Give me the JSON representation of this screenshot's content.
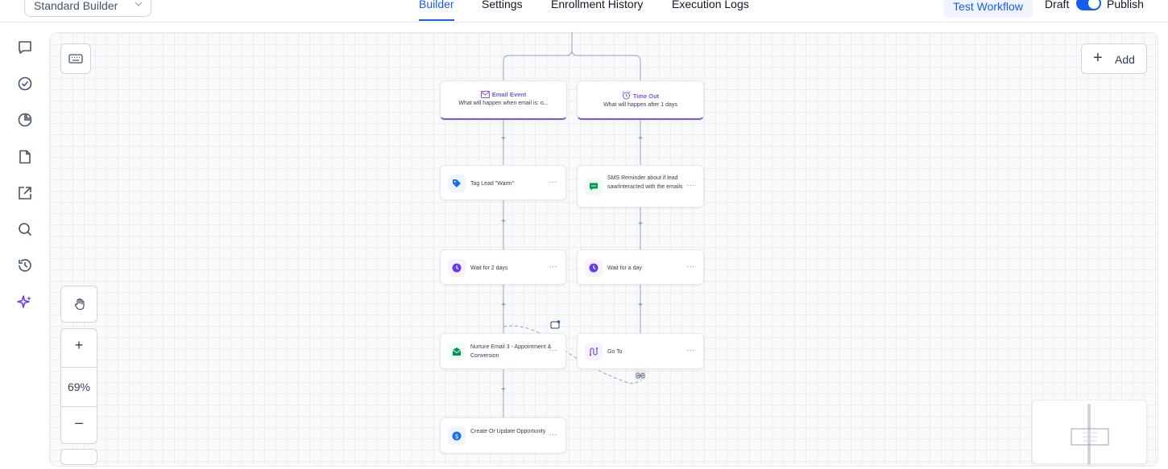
{
  "header": {
    "builder_select": "Standard Builder",
    "tabs": [
      {
        "label": "Builder",
        "active": true
      },
      {
        "label": "Settings",
        "active": false
      },
      {
        "label": "Enrollment History",
        "active": false
      },
      {
        "label": "Execution Logs",
        "active": false
      }
    ],
    "test_workflow": "Test Workflow",
    "draft_label": "Draft",
    "publish_label": "Publish",
    "publish_toggle_on": true
  },
  "rail": {
    "icons": [
      "chat-icon",
      "check-circle-icon",
      "pie-chart-icon",
      "file-icon",
      "external-link-icon",
      "search-icon",
      "history-icon",
      "sparkles-icon"
    ]
  },
  "canvas": {
    "add_label": "Add",
    "zoom_level": "69%",
    "zoom_in": "+",
    "zoom_out": "–"
  },
  "triggers": [
    {
      "title": "Email Event",
      "subtitle": "What will happen when email is: o...",
      "icon": "envelope-icon"
    },
    {
      "title": "Time Out",
      "subtitle": "What will happen after 1 days",
      "icon": "alarm-icon"
    }
  ],
  "left_branch": [
    {
      "label": "Tag Lead \"Warm\"",
      "icon": "tag-icon"
    },
    {
      "label": "Wait for 2 days",
      "icon": "clock-icon"
    },
    {
      "label": "Nurture Email 3 - Appointment & Conversion",
      "icon": "email-action-icon"
    },
    {
      "label": "Create Or Update Opportunity",
      "icon": "dollar-icon"
    }
  ],
  "right_branch": [
    {
      "label": "SMS Reminder about if lead saw/interacted with the emails",
      "icon": "sms-icon"
    },
    {
      "label": "Wait for a day",
      "icon": "clock-icon"
    },
    {
      "label": "Go To",
      "icon": "goto-icon"
    }
  ],
  "more_menu": "···",
  "plus_connector": "+",
  "colors": {
    "accent": "#155eef",
    "purple": "#7f56d9",
    "tag_blue": "#1570ef",
    "clock_purple": "#6938ef",
    "email_green": "#079455",
    "sms_green": "#039855"
  }
}
